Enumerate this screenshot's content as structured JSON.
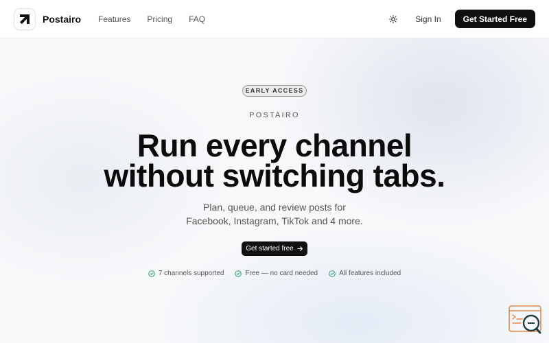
{
  "header": {
    "brand": "Postairo",
    "nav": [
      "Features",
      "Pricing",
      "FAQ"
    ],
    "theme_icon": "sun-icon",
    "signin_label": "Sign In",
    "cta_label": "Get Started Free"
  },
  "hero": {
    "badge": "EARLY ACCESS",
    "eyebrow": "POSTAIRO",
    "headline_line1": "Run every channel",
    "headline_line2": "without switching tabs.",
    "sub_line1": "Plan, queue, and review posts for",
    "sub_line2": "Facebook, Instagram, TikTok and 4 more.",
    "cta_label": "Get started free",
    "cta_icon": "arrow-right-icon"
  },
  "features": [
    "7 channels supported",
    "Free — no card needed",
    "All features included"
  ],
  "colors": {
    "primary": "#111111",
    "check": "#2f9e6e",
    "widget": "#e08a4e"
  }
}
